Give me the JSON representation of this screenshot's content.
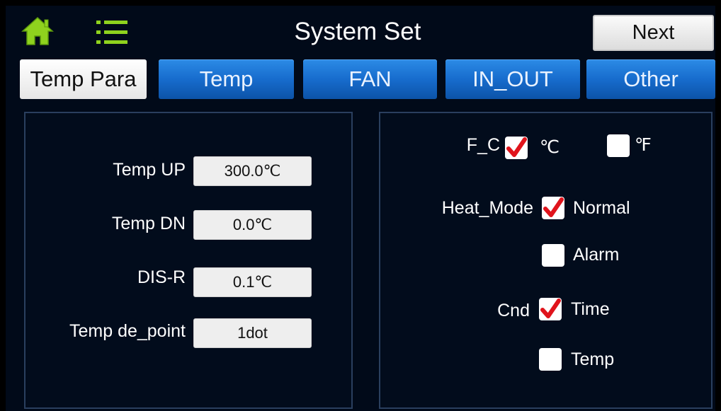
{
  "header": {
    "title": "System Set",
    "next_label": "Next",
    "home_icon": "home-icon",
    "menu_icon": "list-menu-icon"
  },
  "tabs": [
    {
      "label": "Temp Para",
      "active": true
    },
    {
      "label": "Temp",
      "active": false
    },
    {
      "label": "FAN",
      "active": false
    },
    {
      "label": "IN_OUT",
      "active": false
    },
    {
      "label": "Other",
      "active": false
    }
  ],
  "left_panel": {
    "rows": [
      {
        "label": "Temp UP",
        "value": "300.0℃"
      },
      {
        "label": "Temp DN",
        "value": "0.0℃"
      },
      {
        "label": "DIS-R",
        "value": "0.1℃"
      },
      {
        "label": "Temp de_point",
        "value": "1dot"
      }
    ]
  },
  "right_panel": {
    "fc": {
      "label": "F_C",
      "celsius": {
        "label": "℃",
        "checked": true
      },
      "fahrenheit": {
        "label": "℉",
        "checked": false
      }
    },
    "heat_mode": {
      "label": "Heat_Mode",
      "normal": {
        "label": "Normal",
        "checked": true
      },
      "alarm": {
        "label": "Alarm",
        "checked": false
      }
    },
    "cnd": {
      "label": "Cnd",
      "time": {
        "label": "Time",
        "checked": true
      },
      "temp": {
        "label": "Temp",
        "checked": false
      }
    }
  },
  "colors": {
    "background": "#010a19",
    "tab_blue": "#176ccd",
    "check_red": "#e0141c",
    "home_green": "#8fd21e"
  }
}
